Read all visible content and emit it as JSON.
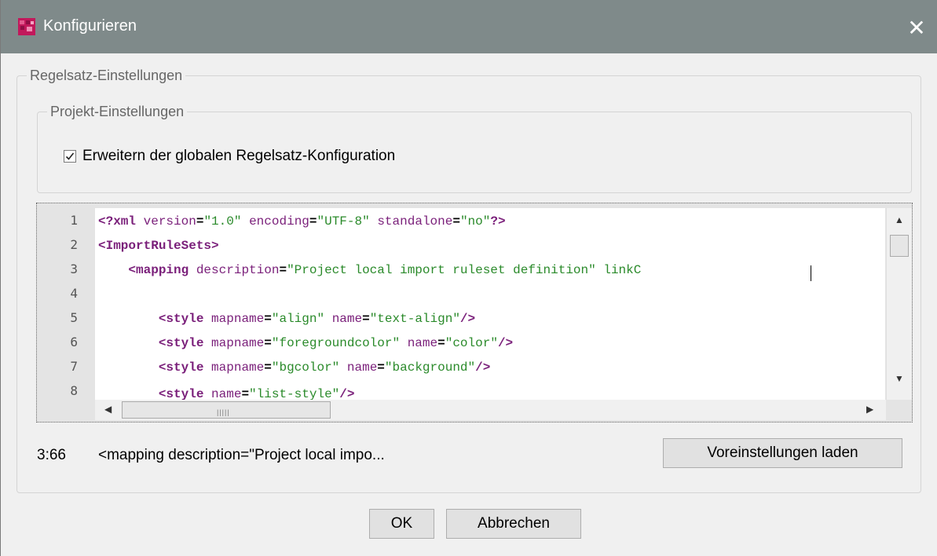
{
  "window": {
    "title": "Konfigurieren",
    "close_icon": "close-icon",
    "app_icon": "app-icon",
    "brand_color": "#c2185b"
  },
  "outer_group": {
    "legend": "Regelsatz-Einstellungen"
  },
  "inner_group": {
    "legend": "Projekt-Einstellungen",
    "checkbox_label": "Erweitern der globalen Regelsatz-Konfiguration",
    "checked": true
  },
  "editor": {
    "line_numbers": [
      "1",
      "2",
      "3",
      "4",
      "5",
      "6",
      "7",
      "8"
    ],
    "lines": [
      "<?xml version=\"1.0\" encoding=\"UTF-8\" standalone=\"no\"?>",
      "<ImportRuleSets>",
      "    <mapping description=\"Project local import ruleset definition\" linkC",
      "",
      "        <style mapname=\"align\" name=\"text-align\"/>",
      "        <style mapname=\"foregroundcolor\" name=\"color\"/>",
      "        <style mapname=\"bgcolor\" name=\"background\"/>",
      "        <style name=\"list-style\"/>"
    ]
  },
  "status": {
    "cursor_position": "3:66",
    "context": "<mapping description=\"Project local impo..."
  },
  "buttons": {
    "reset": "Voreinstellungen laden",
    "ok": "OK",
    "cancel": "Abbrechen"
  }
}
